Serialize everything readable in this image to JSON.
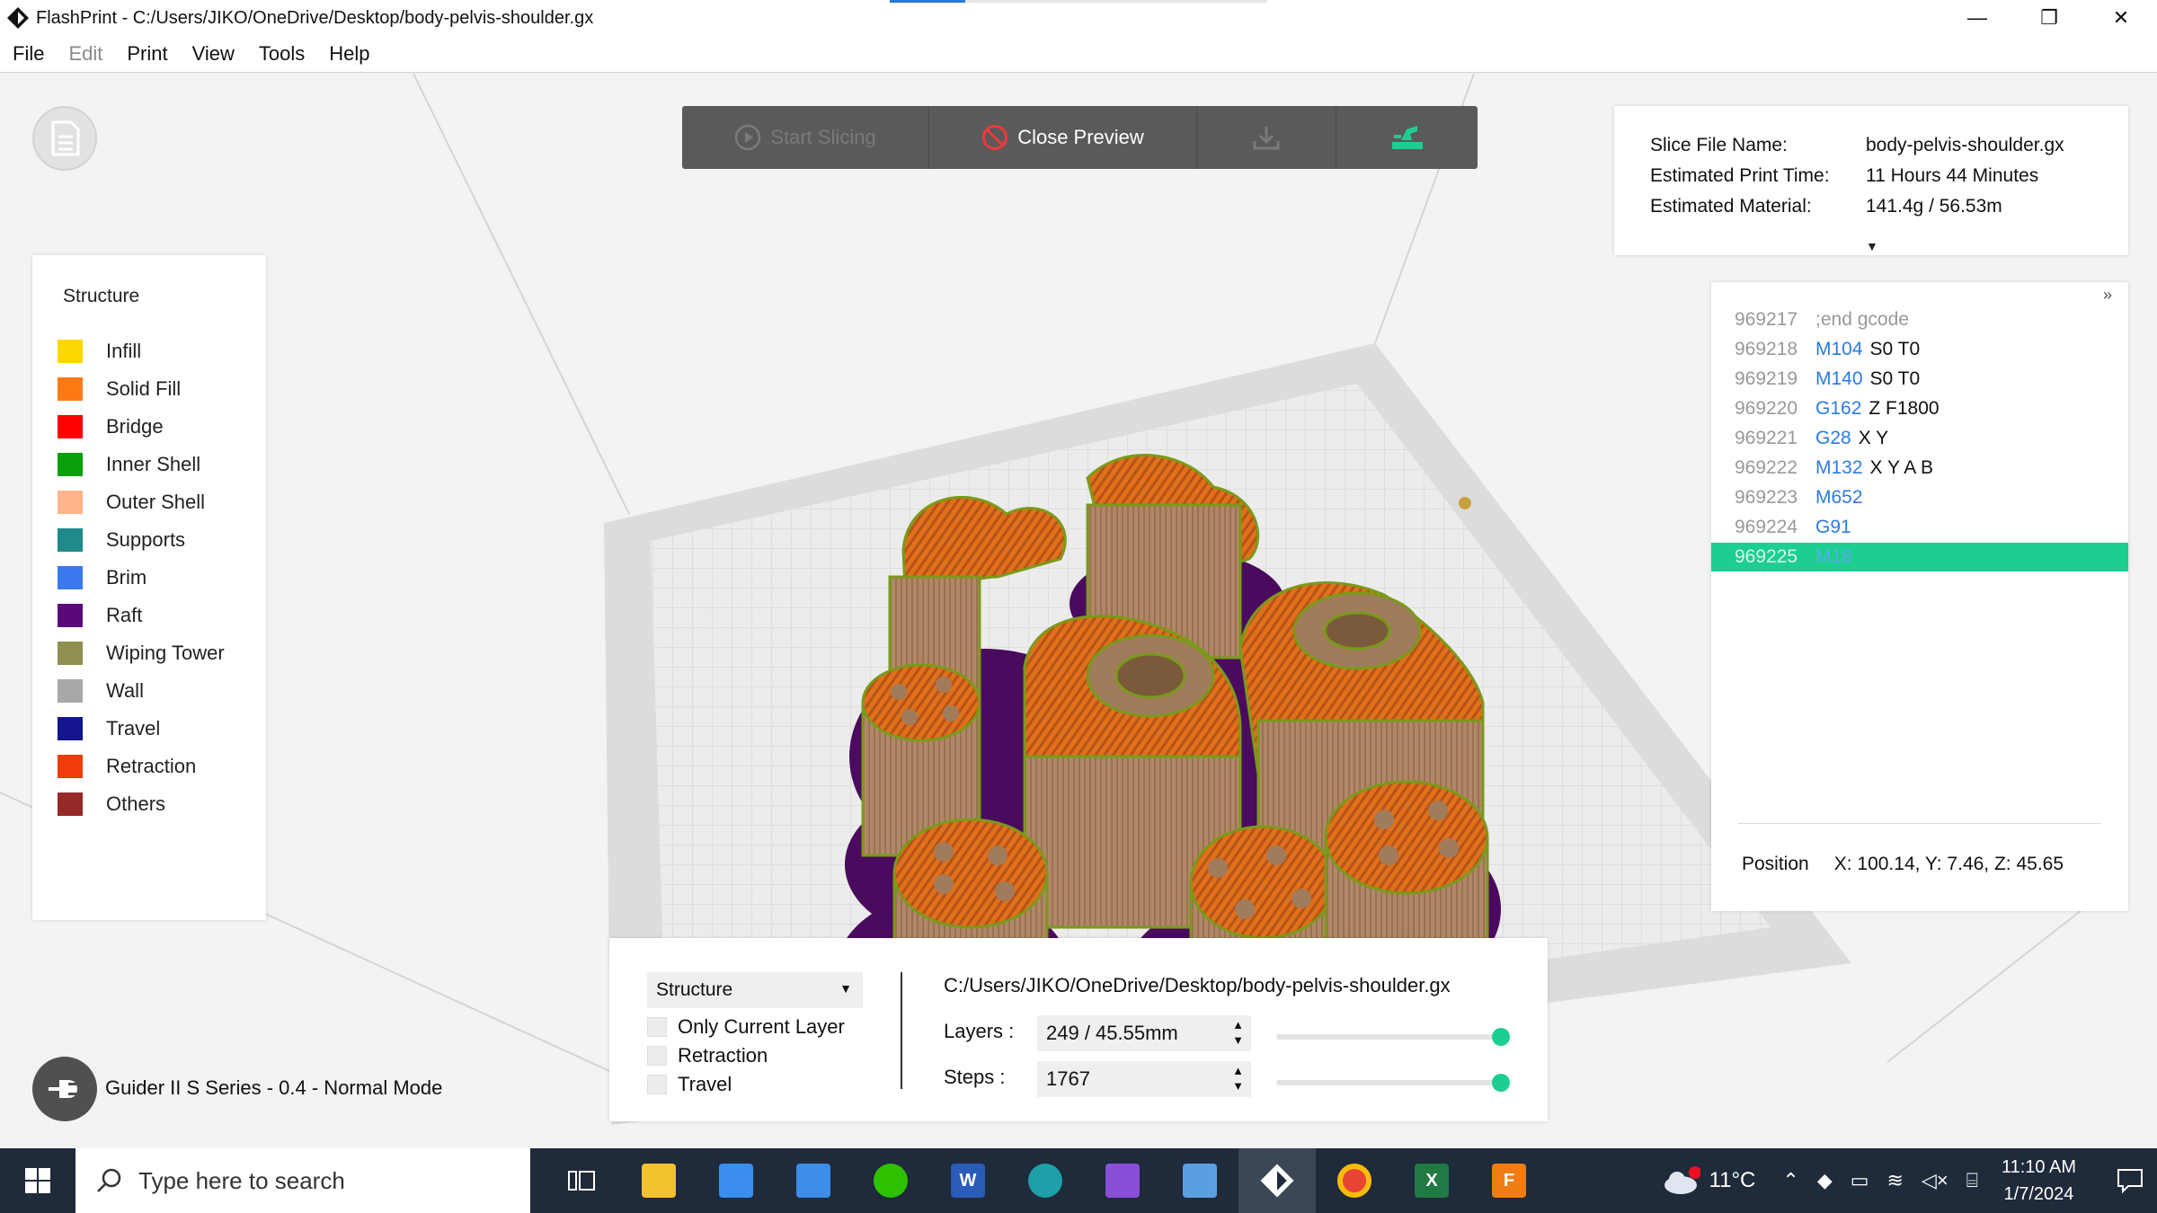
{
  "window": {
    "title": "FlashPrint - C:/Users/JIKO/OneDrive/Desktop/body-pelvis-shoulder.gx",
    "controls": {
      "minimize": "—",
      "restore": "❐",
      "close": "✕"
    }
  },
  "menu": {
    "items": [
      {
        "label": "File",
        "enabled": true
      },
      {
        "label": "Edit",
        "enabled": false
      },
      {
        "label": "Print",
        "enabled": true
      },
      {
        "label": "View",
        "enabled": true
      },
      {
        "label": "Tools",
        "enabled": true
      },
      {
        "label": "Help",
        "enabled": true
      }
    ]
  },
  "toolbar": {
    "start_slicing": "Start Slicing",
    "close_preview": "Close Preview",
    "accent_color": "#1ccf90"
  },
  "legend": {
    "title": "Structure",
    "items": [
      {
        "label": "Infill",
        "color": "#ffd700"
      },
      {
        "label": "Solid Fill",
        "color": "#ff7a14"
      },
      {
        "label": "Bridge",
        "color": "#ff0000"
      },
      {
        "label": "Inner Shell",
        "color": "#0aa00a"
      },
      {
        "label": "Outer Shell",
        "color": "#ffb48a"
      },
      {
        "label": "Supports",
        "color": "#1e8a8a"
      },
      {
        "label": "Brim",
        "color": "#3c78f0"
      },
      {
        "label": "Raft",
        "color": "#5a0a78"
      },
      {
        "label": "Wiping Tower",
        "color": "#8f8f50"
      },
      {
        "label": "Wall",
        "color": "#a8a8a8"
      },
      {
        "label": "Travel",
        "color": "#14148c"
      },
      {
        "label": "Retraction",
        "color": "#f03c0a"
      },
      {
        "label": "Others",
        "color": "#962828"
      }
    ]
  },
  "slice_info": {
    "file_name_label": "Slice File Name:",
    "file_name": "body-pelvis-shoulder.gx",
    "print_time_label": "Estimated Print Time:",
    "print_time": "11 Hours 44 Minutes",
    "material_label": "Estimated Material:",
    "material": "141.4g / 56.53m"
  },
  "gcode": {
    "expand": "»",
    "lines": [
      {
        "num": "969217",
        "cmd": ";end gcode",
        "args": "",
        "comment": true
      },
      {
        "num": "969218",
        "cmd": "M104",
        "args": "S0 T0"
      },
      {
        "num": "969219",
        "cmd": "M140",
        "args": "S0 T0"
      },
      {
        "num": "969220",
        "cmd": "G162",
        "args": "Z F1800"
      },
      {
        "num": "969221",
        "cmd": "G28",
        "args": "X Y"
      },
      {
        "num": "969222",
        "cmd": "M132",
        "args": "X Y A B"
      },
      {
        "num": "969223",
        "cmd": "M652",
        "args": ""
      },
      {
        "num": "969224",
        "cmd": "G91",
        "args": ""
      },
      {
        "num": "969225",
        "cmd": "M18",
        "args": "",
        "selected": true
      }
    ],
    "position_label": "Position",
    "position_value": "X: 100.14, Y: 7.46, Z: 45.65"
  },
  "controls": {
    "view_mode": "Structure",
    "checkboxes": [
      {
        "label": "Only Current Layer",
        "checked": false
      },
      {
        "label": "Retraction",
        "checked": false
      },
      {
        "label": "Travel",
        "checked": false
      }
    ],
    "file_path": "C:/Users/JIKO/OneDrive/Desktop/body-pelvis-shoulder.gx",
    "layers_label": "Layers :",
    "layers_value": "249 / 45.55mm",
    "layers_slider_fraction": 1.0,
    "steps_label": "Steps :",
    "steps_value": "1767",
    "steps_slider_fraction": 1.0
  },
  "printer": {
    "label": "Guider II S Series - 0.4 - Normal Mode"
  },
  "taskbar": {
    "search_placeholder": "Type here to search",
    "temperature": "11°C",
    "weather_badge": "1",
    "time": "11:10 AM",
    "date": "1/7/2024",
    "notification_count": "1",
    "apps": [
      {
        "name": "task-view-icon"
      },
      {
        "name": "file-explorer-icon"
      },
      {
        "name": "microsoft-store-icon"
      },
      {
        "name": "mail-icon"
      },
      {
        "name": "wechat-icon"
      },
      {
        "name": "word-icon"
      },
      {
        "name": "edge-icon"
      },
      {
        "name": "clipchamp-icon"
      },
      {
        "name": "control-panel-icon"
      },
      {
        "name": "flashprint-icon",
        "active": true
      },
      {
        "name": "chrome-icon"
      },
      {
        "name": "excel-icon"
      },
      {
        "name": "flashforge-icon"
      }
    ]
  }
}
